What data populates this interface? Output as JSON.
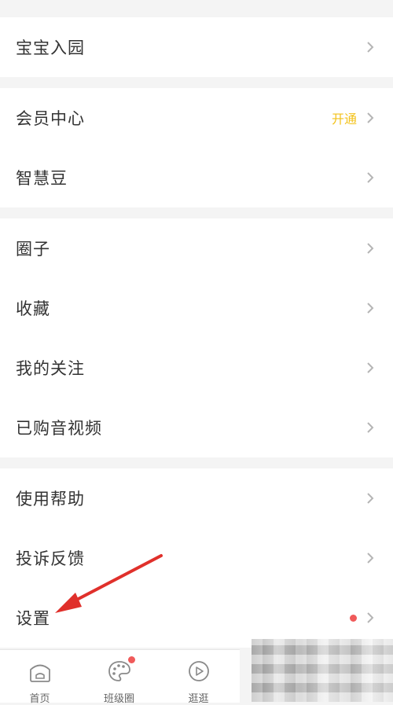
{
  "groups": [
    {
      "items": [
        {
          "label": "宝宝入园"
        }
      ]
    },
    {
      "items": [
        {
          "label": "会员中心",
          "badge": "开通"
        },
        {
          "label": "智慧豆"
        }
      ]
    },
    {
      "items": [
        {
          "label": "圈子"
        },
        {
          "label": "收藏"
        },
        {
          "label": "我的关注"
        },
        {
          "label": "已购音视频"
        }
      ]
    },
    {
      "items": [
        {
          "label": "使用帮助"
        },
        {
          "label": "投诉反馈"
        },
        {
          "label": "设置",
          "has_dot": true
        }
      ]
    }
  ],
  "bottom_nav": {
    "items": [
      {
        "label": "首页",
        "icon": "home-icon"
      },
      {
        "label": "班级圈",
        "icon": "palette-icon",
        "has_dot": true
      },
      {
        "label": "逛逛",
        "icon": "play-icon"
      }
    ]
  },
  "colors": {
    "accent_yellow": "#f3c21a",
    "notification_red": "#f05a5a",
    "annotation_arrow": "#e0302b"
  },
  "annotation": {
    "type": "arrow",
    "points_to": "设置"
  }
}
